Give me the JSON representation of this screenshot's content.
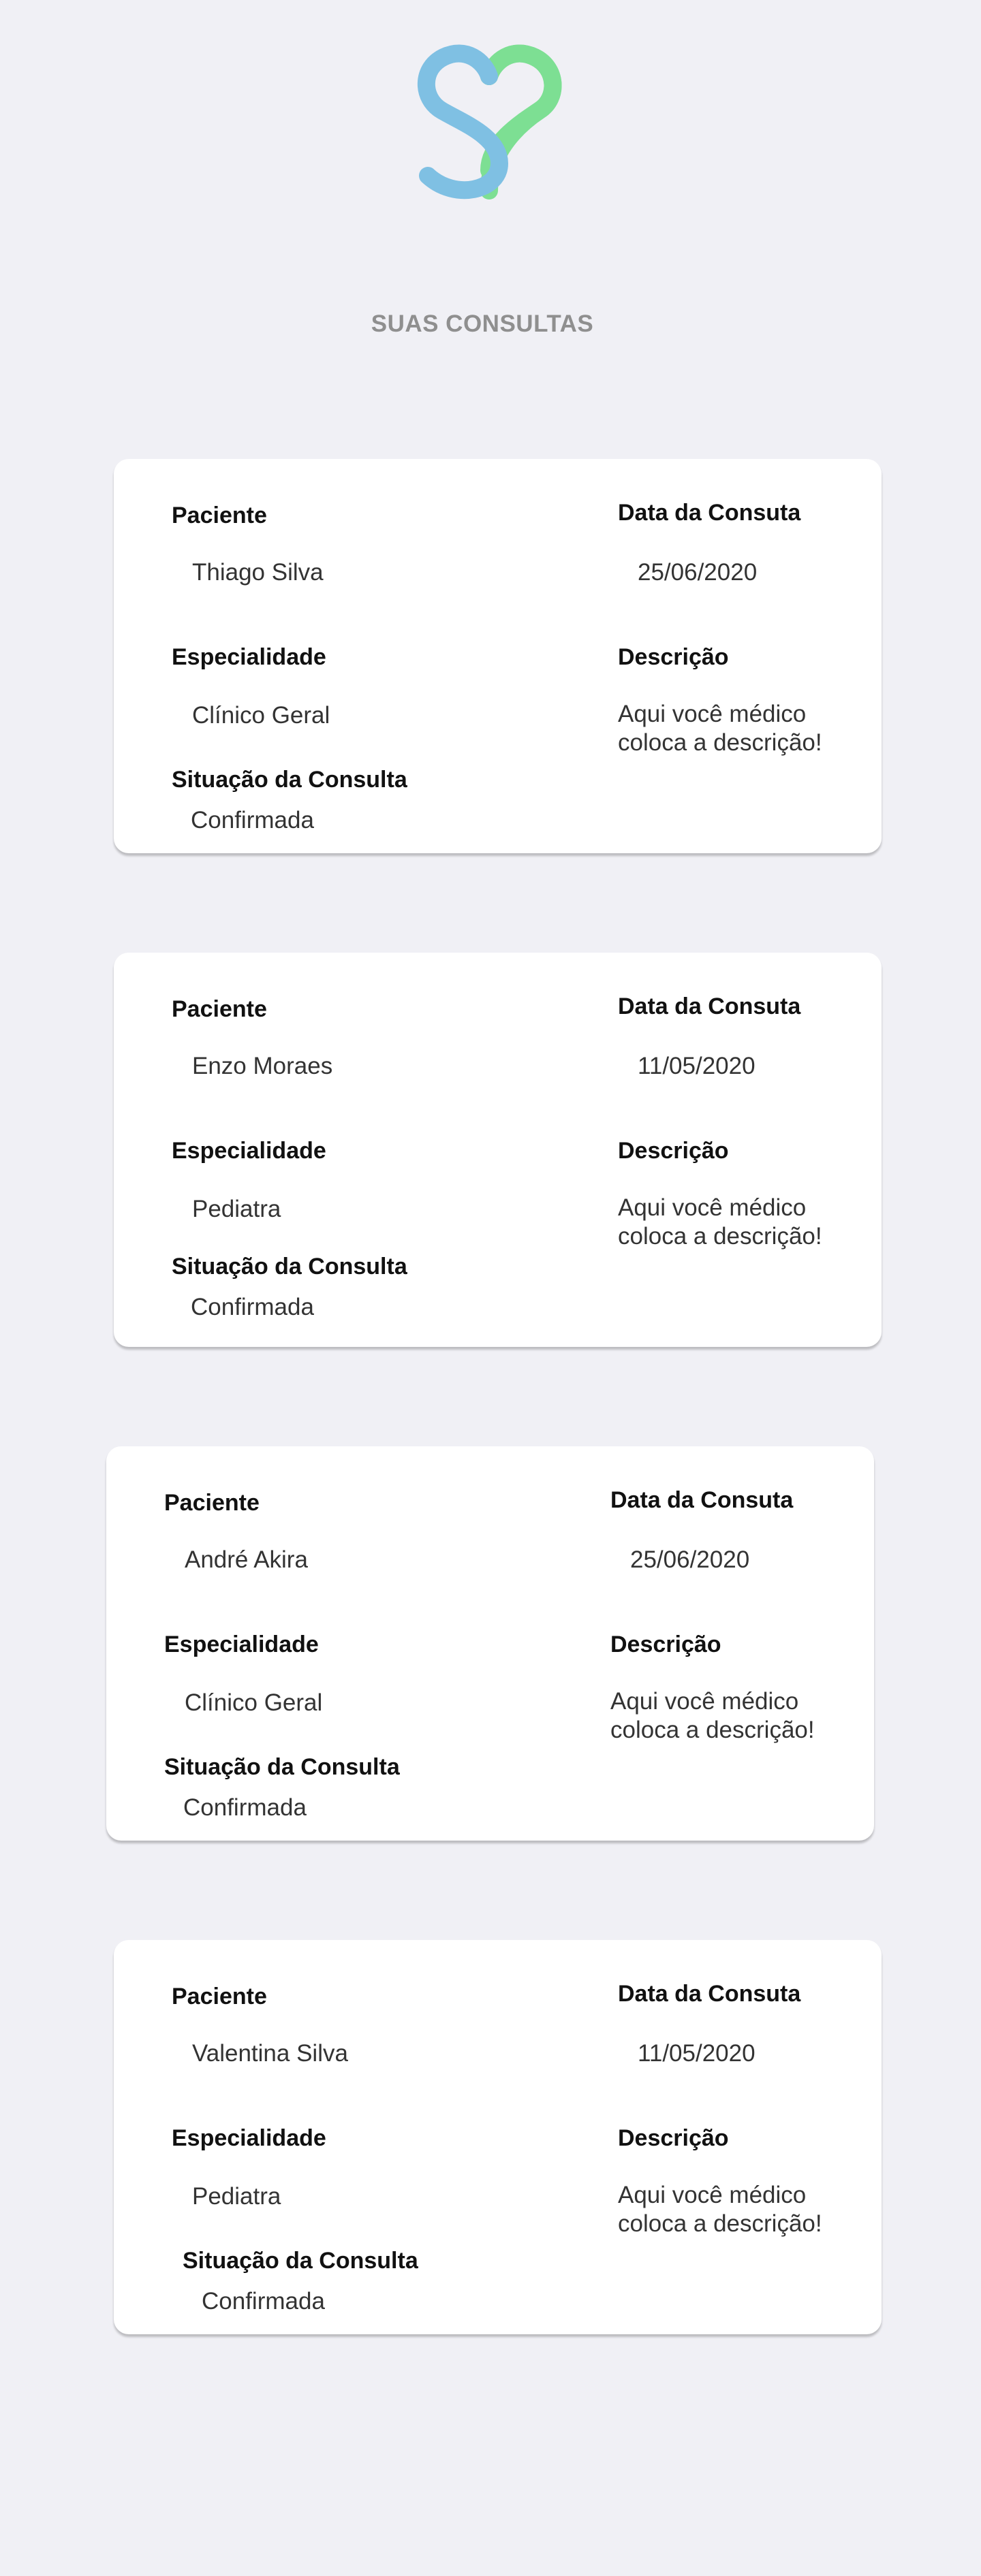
{
  "header": {
    "title": "SUAS CONSULTAS"
  },
  "colors": {
    "background": "#f0f0f5",
    "logo_blue": "#7fc0e3",
    "logo_green": "#7ddf93",
    "title_gray": "#8f8f8f"
  },
  "labels": {
    "patient": "Paciente",
    "date": "Data da Consuta",
    "specialty": "Especialidade",
    "description": "Descrição",
    "status": "Situação da Consulta"
  },
  "appointments": [
    {
      "patient": "Thiago Silva",
      "date": "25/06/2020",
      "specialty": "Clínico Geral",
      "description": "Aqui você médico coloca a descrição!",
      "status": "Confirmada"
    },
    {
      "patient": "Enzo Moraes",
      "date": "11/05/2020",
      "specialty": "Pediatra",
      "description": "Aqui você médico coloca a descrição!",
      "status": "Confirmada"
    },
    {
      "patient": "André Akira",
      "date": "25/06/2020",
      "specialty": "Clínico Geral",
      "description": "Aqui você médico coloca a descrição!",
      "status": "Confirmada"
    },
    {
      "patient": "Valentina Silva",
      "date": "11/05/2020",
      "specialty": "Pediatra",
      "description": "Aqui você médico coloca a descrição!",
      "status": "Confirmada"
    }
  ]
}
